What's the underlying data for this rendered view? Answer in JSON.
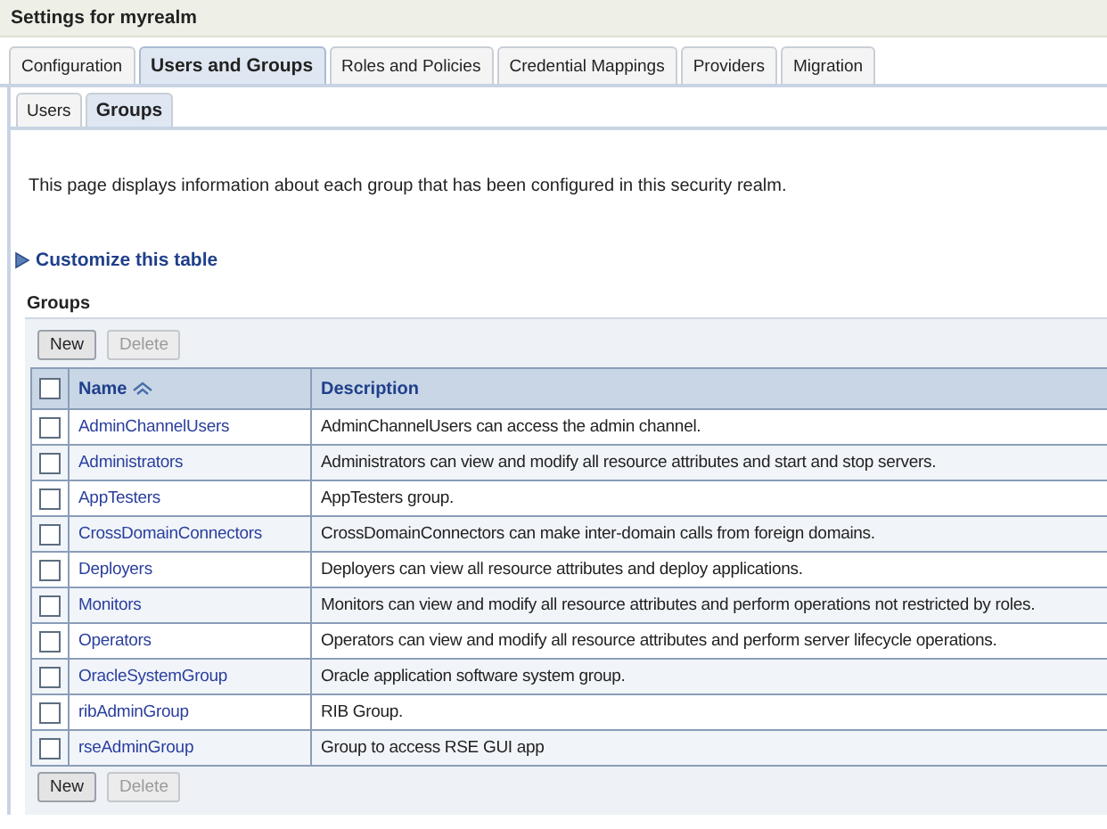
{
  "title": "Settings for myrealm",
  "tabs": [
    {
      "label": "Configuration",
      "selected": false
    },
    {
      "label": "Users and Groups",
      "selected": true
    },
    {
      "label": "Roles and Policies",
      "selected": false
    },
    {
      "label": "Credential Mappings",
      "selected": false
    },
    {
      "label": "Providers",
      "selected": false
    },
    {
      "label": "Migration",
      "selected": false
    }
  ],
  "subtabs": [
    {
      "label": "Users",
      "selected": false
    },
    {
      "label": "Groups",
      "selected": true
    }
  ],
  "intro": "This page displays information about each group that has been configured in this security realm.",
  "customize_link": "Customize this table",
  "table": {
    "title": "Groups",
    "top_buttons": [
      {
        "label": "New",
        "disabled": false
      },
      {
        "label": "Delete",
        "disabled": true
      }
    ],
    "select_all": {
      "checked": false
    },
    "columns": [
      {
        "label": "Name",
        "sorted": true
      },
      {
        "label": "Description",
        "sorted": false
      }
    ],
    "rows": [
      {
        "name": "AdminChannelUsers",
        "description": "AdminChannelUsers can access the admin channel.",
        "checked": false
      },
      {
        "name": "Administrators",
        "description": "Administrators can view and modify all resource attributes and start and stop servers.",
        "checked": false
      },
      {
        "name": "AppTesters",
        "description": "AppTesters group.",
        "checked": false
      },
      {
        "name": "CrossDomainConnectors",
        "description": "CrossDomainConnectors can make inter-domain calls from foreign domains.",
        "checked": false
      },
      {
        "name": "Deployers",
        "description": "Deployers can view all resource attributes and deploy applications.",
        "checked": false
      },
      {
        "name": "Monitors",
        "description": "Monitors can view and modify all resource attributes and perform operations not restricted by roles.",
        "checked": false
      },
      {
        "name": "Operators",
        "description": "Operators can view and modify all resource attributes and perform server lifecycle operations.",
        "checked": false
      },
      {
        "name": "OracleSystemGroup",
        "description": "Oracle application software system group.",
        "checked": false
      },
      {
        "name": "ribAdminGroup",
        "description": "RIB Group.",
        "checked": false
      },
      {
        "name": "rseAdminGroup",
        "description": "Group to access RSE GUI app",
        "checked": false
      }
    ],
    "bottom_buttons": [
      {
        "label": "New",
        "disabled": false
      },
      {
        "label": "Delete",
        "disabled": true
      }
    ]
  }
}
